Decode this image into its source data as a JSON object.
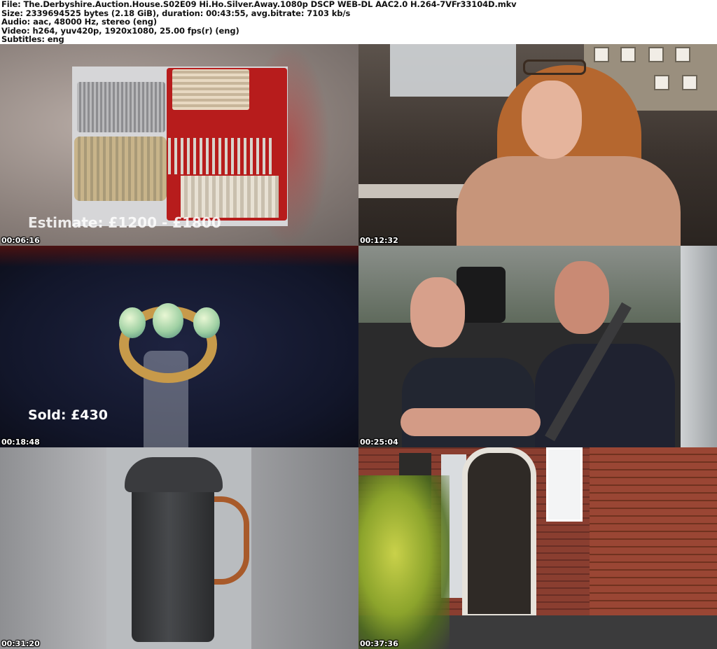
{
  "header": {
    "file": "File: The.Derbyshire.Auction.House.S02E09 Hi.Ho.Silver.Away.1080p DSCP WEB-DL AAC2.0 H.264-7VFr33104D.mkv",
    "size": "Size: 2339694525 bytes (2.18 GiB), duration: 00:43:55, avg.bitrate: 7103 kb/s",
    "audio": "Audio: aac, 48000 Hz, stereo (eng)",
    "video": "Video: h264, yuv420p, 1920x1080, 25.00 fps(r) (eng)",
    "subtitles": "Subtitles: eng"
  },
  "thumbnails": [
    {
      "timestamp": "00:06:16",
      "caption": "Estimate: £1200 - £1800"
    },
    {
      "timestamp": "00:12:32"
    },
    {
      "timestamp": "00:18:48",
      "caption": "Sold: £430"
    },
    {
      "timestamp": "00:25:04"
    },
    {
      "timestamp": "00:31:20"
    },
    {
      "timestamp": "00:37:36"
    }
  ]
}
